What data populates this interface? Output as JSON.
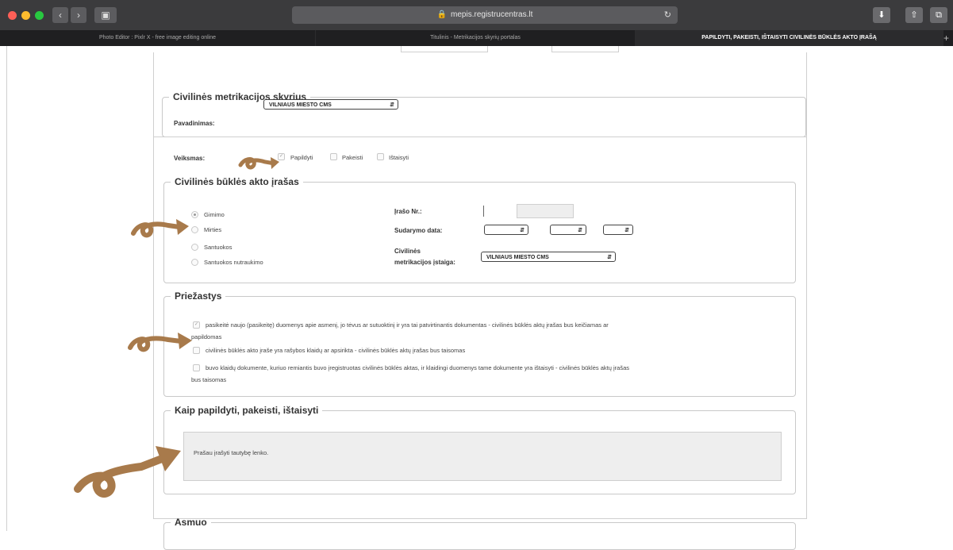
{
  "browser": {
    "url": "mepis.registrucentras.lt",
    "tabs": [
      {
        "label": "Photo Editor : Pixlr X - free image editing online"
      },
      {
        "label": "Titulinis - Metrikacijos skyrių portalas"
      },
      {
        "label": "PAPILDYTI, PAKEISTI, IŠTAISYTI CIVILINĖS BŪKLĖS AKTO ĮRAŠĄ"
      }
    ],
    "plus": "+"
  },
  "cms_section": {
    "legend": "Civilinės metrikacijos skyrius",
    "name_label": "Pavadinimas:",
    "name_value": "VILNIAUS MIESTO CMS"
  },
  "action": {
    "label": "Veiksmas:",
    "options": [
      "Papildyti",
      "Pakeisti",
      "Ištaisyti"
    ]
  },
  "record_section": {
    "legend": "Civilinės būklės akto įrašas",
    "types": [
      "Gimimo",
      "Mirties",
      "Santuokos",
      "Santuokos nutraukimo"
    ],
    "record_no_label": "Įrašo Nr.:",
    "date_label": "Sudarymo data:",
    "institution_label_1": "Civilinės",
    "institution_label_2": "metrikacijos įstaiga:",
    "institution_value": "VILNIAUS MIESTO CMS"
  },
  "reasons_section": {
    "legend": "Priežastys",
    "r1_line1": "pasikeitė naujo (pasikeitę) duomenys apie asmenį, jo tėvus ar sutuoktinį ir yra tai patvirtinantis dokumentas - civilinės būklės aktų įrašas bus keičiamas ar",
    "r1_line2": "papildomas",
    "r2": "civilinės būklės akto įraše yra rašybos klaidų ar apsirikta - civilinės būklės aktų įrašas bus taisomas",
    "r3_line1": "buvo klaidų dokumente, kuriuo remiantis buvo įregistruotas civilinės būklės aktas, ir klaidingi duomenys tame dokumente yra ištaisyti - civilinės būklės aktų įrašas",
    "r3_line2": "bus taisomas"
  },
  "how_section": {
    "legend": "Kaip papildyti, pakeisti, ištaisyti",
    "text": "Prašau įrašyti tautybę lenko."
  },
  "person_section": {
    "legend": "Asmuo"
  },
  "colors": {
    "annotation_arrow": "#a87a4b",
    "chrome_dark": "#3b3b3d",
    "tab_bar": "#1f1f21"
  }
}
